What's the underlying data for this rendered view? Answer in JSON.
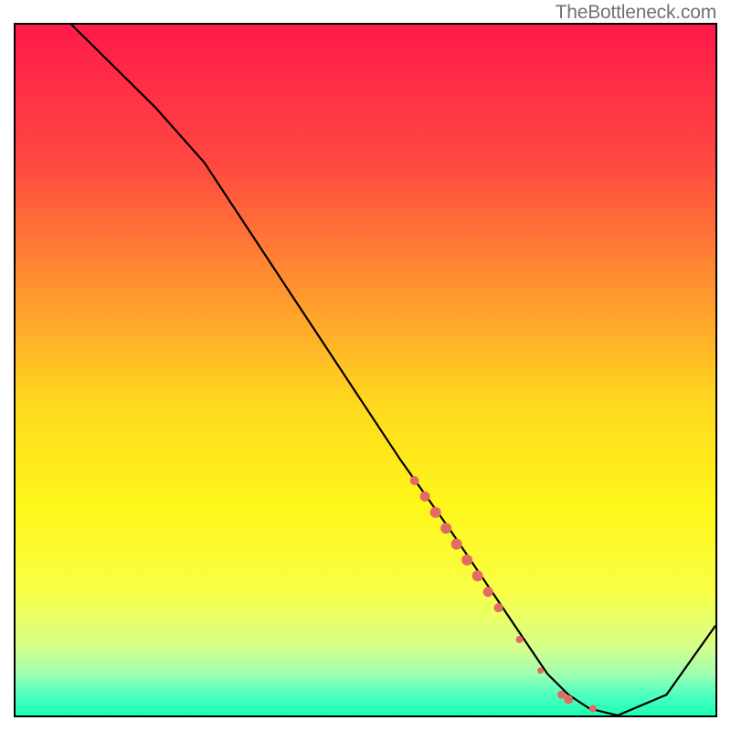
{
  "watermark": "TheBottleneck.com",
  "chart_data": {
    "type": "line",
    "title": "",
    "xlabel": "",
    "ylabel": "",
    "xlim": [
      0,
      100
    ],
    "ylim": [
      0,
      100
    ],
    "background": {
      "type": "vertical_gradient",
      "stops": [
        {
          "pos": 0.0,
          "color": "#ff1a49"
        },
        {
          "pos": 0.2,
          "color": "#ff4840"
        },
        {
          "pos": 0.4,
          "color": "#ff9b2e"
        },
        {
          "pos": 0.55,
          "color": "#ffd91e"
        },
        {
          "pos": 0.7,
          "color": "#fff71a"
        },
        {
          "pos": 0.82,
          "color": "#f8ff45"
        },
        {
          "pos": 0.9,
          "color": "#d7ff8a"
        },
        {
          "pos": 0.94,
          "color": "#9effb0"
        },
        {
          "pos": 0.97,
          "color": "#4effc0"
        },
        {
          "pos": 1.0,
          "color": "#1bffb3"
        }
      ]
    },
    "series": [
      {
        "name": "curve",
        "stroke": "#000000",
        "x": [
          0,
          8,
          20,
          27,
          40,
          55,
          62,
          68,
          72,
          76,
          79,
          82,
          86,
          93,
          100
        ],
        "y": [
          108,
          100,
          88,
          80,
          60,
          37,
          27,
          18,
          12,
          6,
          3,
          1,
          0,
          3,
          13
        ]
      }
    ],
    "markers": {
      "name": "highlight-band",
      "color": "#e46a66",
      "points": [
        {
          "x": 57,
          "y": 34,
          "r": 5
        },
        {
          "x": 58.5,
          "y": 31.7,
          "r": 5.5
        },
        {
          "x": 60,
          "y": 29.4,
          "r": 6
        },
        {
          "x": 61.5,
          "y": 27.1,
          "r": 6
        },
        {
          "x": 63,
          "y": 24.8,
          "r": 6
        },
        {
          "x": 64.5,
          "y": 22.5,
          "r": 6
        },
        {
          "x": 66,
          "y": 20.2,
          "r": 6
        },
        {
          "x": 67.5,
          "y": 17.9,
          "r": 5.5
        },
        {
          "x": 69,
          "y": 15.6,
          "r": 5
        },
        {
          "x": 72,
          "y": 11,
          "r": 4
        },
        {
          "x": 75,
          "y": 6.5,
          "r": 3.5
        },
        {
          "x": 78,
          "y": 3,
          "r": 4.5
        },
        {
          "x": 79,
          "y": 2.3,
          "r": 5
        },
        {
          "x": 82.5,
          "y": 1,
          "r": 4
        }
      ]
    }
  }
}
